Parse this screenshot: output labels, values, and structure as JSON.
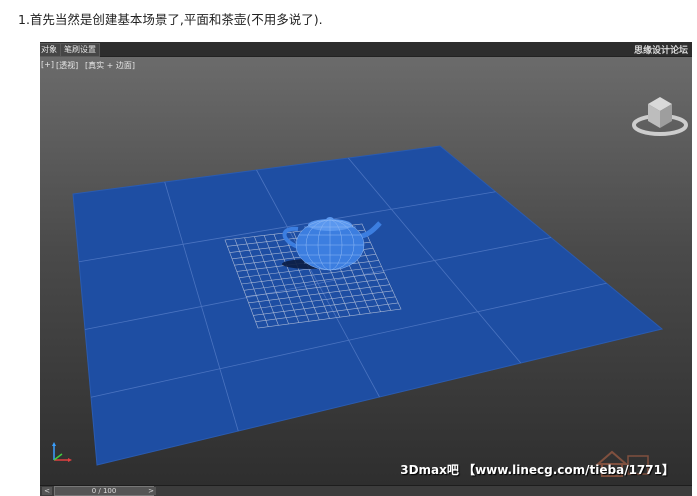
{
  "article": {
    "step_text": "1.首先当然是创建基本场景了,平面和茶壶(不用多说了)."
  },
  "app": {
    "menubar": {
      "items": [
        "对象",
        "笔刷设置"
      ],
      "forum_logo": "思缘设计论坛"
    },
    "viewport": {
      "label_plus": "[+]",
      "label_view": "[透视]",
      "label_shading": "[真实 + 边面]"
    },
    "scene": {
      "plane_color": "#1e4ea3",
      "grid_line_color": "#4a73c0",
      "teapot_color": "#3c7ee0",
      "selection_grid_color": "#a9b8d6"
    },
    "viewcube_icon": "viewcube-icon",
    "axis_gizmo_icon": "axis-gizmo-icon",
    "watermark": {
      "text": "3Dmax吧 【www.linecg.com/tieba/1771】",
      "logo_icon": "3d-house-logo-icon"
    },
    "timeline": {
      "frame_display": "0 / 100",
      "prev_icon": "<",
      "next_icon": ">"
    }
  }
}
